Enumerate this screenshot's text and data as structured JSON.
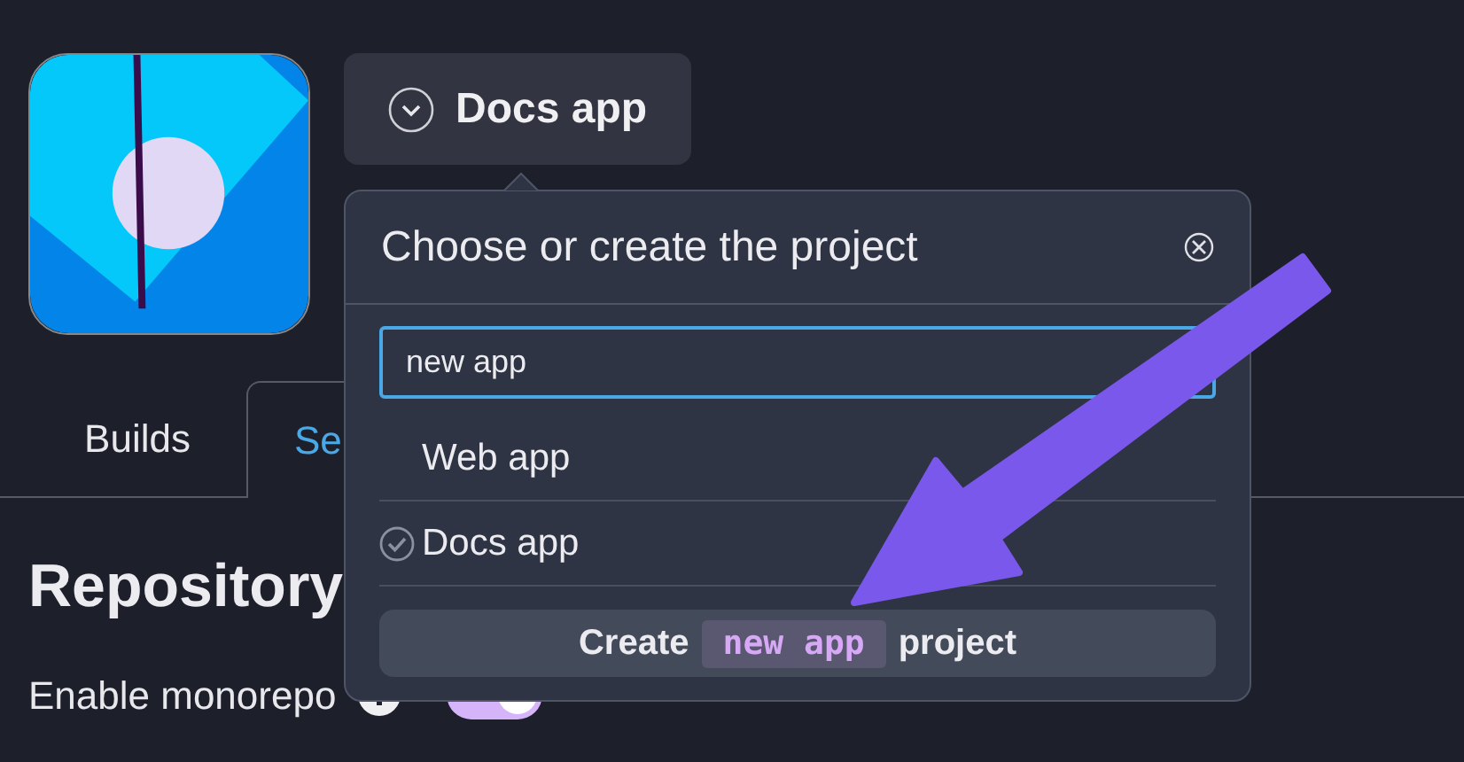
{
  "project_button": {
    "label": "Docs app"
  },
  "tabs": [
    {
      "label": "Builds",
      "selected": false
    },
    {
      "label": "Se",
      "selected": true
    }
  ],
  "heading": "Repository",
  "setting": {
    "label": "Enable monorepo",
    "on": true
  },
  "popover": {
    "title": "Choose or create the project",
    "search": {
      "value": "new app"
    },
    "items": [
      {
        "label": "Web app",
        "selected": false
      },
      {
        "label": "Docs app",
        "selected": true
      }
    ],
    "create_button": {
      "before": "Create",
      "code": "new app",
      "after": "project"
    }
  }
}
